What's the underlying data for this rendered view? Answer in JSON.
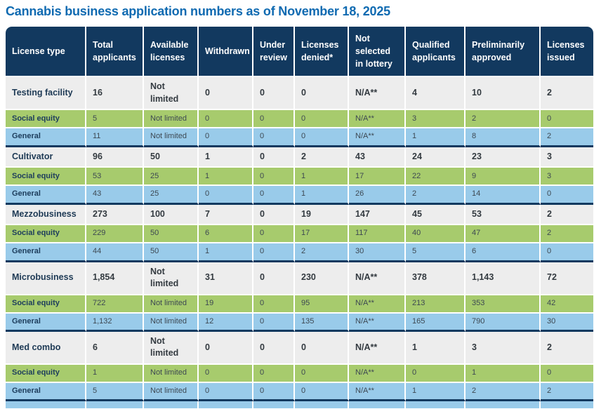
{
  "title": "Cannabis business application numbers as of November 18, 2025",
  "colors": {
    "title_blue": "#0f6ab1",
    "header_navy": "#12395f",
    "group_row_gray": "#ededed",
    "social_equity_green": "#a7cb6d",
    "general_blue": "#99cbea",
    "group_divider_navy": "#12395f"
  },
  "table": {
    "columns": [
      "License type",
      "Total applicants",
      "Available licenses",
      "Withdrawn",
      "Under review",
      "Licenses denied*",
      "Not selected in lottery",
      "Qualified applicants",
      "Preliminarily approved",
      "Licenses issued"
    ],
    "sub_row_labels": {
      "social_equity": "Social equity",
      "general": "General"
    },
    "groups": [
      {
        "main": {
          "label": "Testing facility",
          "values": [
            "16",
            "Not limited",
            "0",
            "0",
            "0",
            "N/A**",
            "4",
            "10",
            "2"
          ]
        },
        "social_equity": [
          "5",
          "Not limited",
          "0",
          "0",
          "0",
          "N/A**",
          "3",
          "2",
          "0"
        ],
        "general": [
          "11",
          "Not limited",
          "0",
          "0",
          "0",
          "N/A**",
          "1",
          "8",
          "2"
        ]
      },
      {
        "main": {
          "label": "Cultivator",
          "values": [
            "96",
            "50",
            "1",
            "0",
            "2",
            "43",
            "24",
            "23",
            "3"
          ]
        },
        "social_equity": [
          "53",
          "25",
          "1",
          "0",
          "1",
          "17",
          "22",
          "9",
          "3"
        ],
        "general": [
          "43",
          "25",
          "0",
          "0",
          "1",
          "26",
          "2",
          "14",
          "0"
        ]
      },
      {
        "main": {
          "label": "Mezzobusiness",
          "values": [
            "273",
            "100",
            "7",
            "0",
            "19",
            "147",
            "45",
            "53",
            "2"
          ]
        },
        "social_equity": [
          "229",
          "50",
          "6",
          "0",
          "17",
          "117",
          "40",
          "47",
          "2"
        ],
        "general": [
          "44",
          "50",
          "1",
          "0",
          "2",
          "30",
          "5",
          "6",
          "0"
        ]
      },
      {
        "main": {
          "label": "Microbusiness",
          "values": [
            "1,854",
            "Not limited",
            "31",
            "0",
            "230",
            "N/A**",
            "378",
            "1,143",
            "72"
          ]
        },
        "social_equity": [
          "722",
          "Not limited",
          "19",
          "0",
          "95",
          "N/A**",
          "213",
          "353",
          "42"
        ],
        "general": [
          "1,132",
          "Not limited",
          "12",
          "0",
          "135",
          "N/A**",
          "165",
          "790",
          "30"
        ]
      },
      {
        "main": {
          "label": "Med combo",
          "values": [
            "6",
            "Not limited",
            "0",
            "0",
            "0",
            "N/A**",
            "1",
            "3",
            "2"
          ]
        },
        "social_equity": [
          "1",
          "Not limited",
          "0",
          "0",
          "0",
          "N/A**",
          "0",
          "1",
          "0"
        ],
        "general": [
          "5",
          "Not limited",
          "0",
          "0",
          "0",
          "N/A**",
          "1",
          "2",
          "2"
        ]
      }
    ]
  },
  "chart_data": {
    "type": "table",
    "title": "Cannabis business application numbers as of November 18, 2025",
    "columns": [
      "License type",
      "Total applicants",
      "Available licenses",
      "Withdrawn",
      "Under review",
      "Licenses denied*",
      "Not selected in lottery",
      "Qualified applicants",
      "Preliminarily approved",
      "Licenses issued"
    ],
    "rows": [
      [
        "Testing facility",
        "16",
        "Not limited",
        "0",
        "0",
        "0",
        "N/A**",
        "4",
        "10",
        "2"
      ],
      [
        "Social equity",
        "5",
        "Not limited",
        "0",
        "0",
        "0",
        "N/A**",
        "3",
        "2",
        "0"
      ],
      [
        "General",
        "11",
        "Not limited",
        "0",
        "0",
        "0",
        "N/A**",
        "1",
        "8",
        "2"
      ],
      [
        "Cultivator",
        "96",
        "50",
        "1",
        "0",
        "2",
        "43",
        "24",
        "23",
        "3"
      ],
      [
        "Social equity",
        "53",
        "25",
        "1",
        "0",
        "1",
        "17",
        "22",
        "9",
        "3"
      ],
      [
        "General",
        "43",
        "25",
        "0",
        "0",
        "1",
        "26",
        "2",
        "14",
        "0"
      ],
      [
        "Mezzobusiness",
        "273",
        "100",
        "7",
        "0",
        "19",
        "147",
        "45",
        "53",
        "2"
      ],
      [
        "Social equity",
        "229",
        "50",
        "6",
        "0",
        "17",
        "117",
        "40",
        "47",
        "2"
      ],
      [
        "General",
        "44",
        "50",
        "1",
        "0",
        "2",
        "30",
        "5",
        "6",
        "0"
      ],
      [
        "Microbusiness",
        "1,854",
        "Not limited",
        "31",
        "0",
        "230",
        "N/A**",
        "378",
        "1,143",
        "72"
      ],
      [
        "Social equity",
        "722",
        "Not limited",
        "19",
        "0",
        "95",
        "N/A**",
        "213",
        "353",
        "42"
      ],
      [
        "General",
        "1,132",
        "Not limited",
        "12",
        "0",
        "135",
        "N/A**",
        "165",
        "790",
        "30"
      ],
      [
        "Med combo",
        "6",
        "Not limited",
        "0",
        "0",
        "0",
        "N/A**",
        "1",
        "3",
        "2"
      ],
      [
        "Social equity",
        "1",
        "Not limited",
        "0",
        "0",
        "0",
        "N/A**",
        "0",
        "1",
        "0"
      ],
      [
        "General",
        "5",
        "Not limited",
        "0",
        "0",
        "0",
        "N/A**",
        "1",
        "2",
        "2"
      ]
    ]
  }
}
